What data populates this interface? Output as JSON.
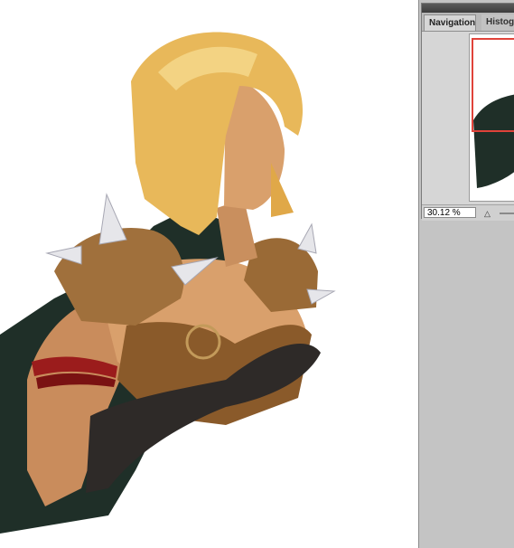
{
  "navigator": {
    "tabs": [
      {
        "label": "Navigation",
        "active": true
      },
      {
        "label": "Histogram",
        "active": false
      }
    ],
    "zoom_value": "30.12 %",
    "view_rect_color": "#e0433a",
    "icons": {
      "zoom_out": "mountain-small-icon",
      "zoom_slider": "zoom-slider"
    }
  },
  "artwork": {
    "subject": "painted-character",
    "colors": {
      "cape": "#1f2f28",
      "hair": "#e8b85a",
      "armor": "#8a5a2a",
      "skin": "#d9a06c",
      "spikes": "#e6e6ea",
      "strap": "#9b1c1c",
      "gauntlet": "#2e2a28"
    }
  }
}
